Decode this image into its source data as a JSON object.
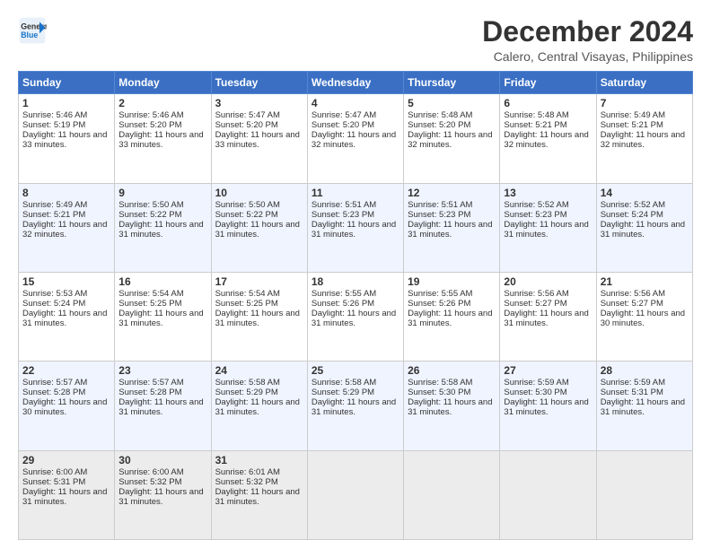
{
  "logo": {
    "line1": "General",
    "line2": "Blue"
  },
  "title": "December 2024",
  "subtitle": "Calero, Central Visayas, Philippines",
  "days": [
    "Sunday",
    "Monday",
    "Tuesday",
    "Wednesday",
    "Thursday",
    "Friday",
    "Saturday"
  ],
  "weeks": [
    [
      {
        "day": 1,
        "rise": "5:46 AM",
        "set": "5:19 PM",
        "hours": "11 hours and 33 minutes."
      },
      {
        "day": 2,
        "rise": "5:46 AM",
        "set": "5:20 PM",
        "hours": "11 hours and 33 minutes."
      },
      {
        "day": 3,
        "rise": "5:47 AM",
        "set": "5:20 PM",
        "hours": "11 hours and 33 minutes."
      },
      {
        "day": 4,
        "rise": "5:47 AM",
        "set": "5:20 PM",
        "hours": "11 hours and 32 minutes."
      },
      {
        "day": 5,
        "rise": "5:48 AM",
        "set": "5:20 PM",
        "hours": "11 hours and 32 minutes."
      },
      {
        "day": 6,
        "rise": "5:48 AM",
        "set": "5:21 PM",
        "hours": "11 hours and 32 minutes."
      },
      {
        "day": 7,
        "rise": "5:49 AM",
        "set": "5:21 PM",
        "hours": "11 hours and 32 minutes."
      }
    ],
    [
      {
        "day": 8,
        "rise": "5:49 AM",
        "set": "5:21 PM",
        "hours": "11 hours and 32 minutes."
      },
      {
        "day": 9,
        "rise": "5:50 AM",
        "set": "5:22 PM",
        "hours": "11 hours and 31 minutes."
      },
      {
        "day": 10,
        "rise": "5:50 AM",
        "set": "5:22 PM",
        "hours": "11 hours and 31 minutes."
      },
      {
        "day": 11,
        "rise": "5:51 AM",
        "set": "5:23 PM",
        "hours": "11 hours and 31 minutes."
      },
      {
        "day": 12,
        "rise": "5:51 AM",
        "set": "5:23 PM",
        "hours": "11 hours and 31 minutes."
      },
      {
        "day": 13,
        "rise": "5:52 AM",
        "set": "5:23 PM",
        "hours": "11 hours and 31 minutes."
      },
      {
        "day": 14,
        "rise": "5:52 AM",
        "set": "5:24 PM",
        "hours": "11 hours and 31 minutes."
      }
    ],
    [
      {
        "day": 15,
        "rise": "5:53 AM",
        "set": "5:24 PM",
        "hours": "11 hours and 31 minutes."
      },
      {
        "day": 16,
        "rise": "5:54 AM",
        "set": "5:25 PM",
        "hours": "11 hours and 31 minutes."
      },
      {
        "day": 17,
        "rise": "5:54 AM",
        "set": "5:25 PM",
        "hours": "11 hours and 31 minutes."
      },
      {
        "day": 18,
        "rise": "5:55 AM",
        "set": "5:26 PM",
        "hours": "11 hours and 31 minutes."
      },
      {
        "day": 19,
        "rise": "5:55 AM",
        "set": "5:26 PM",
        "hours": "11 hours and 31 minutes."
      },
      {
        "day": 20,
        "rise": "5:56 AM",
        "set": "5:27 PM",
        "hours": "11 hours and 31 minutes."
      },
      {
        "day": 21,
        "rise": "5:56 AM",
        "set": "5:27 PM",
        "hours": "11 hours and 30 minutes."
      }
    ],
    [
      {
        "day": 22,
        "rise": "5:57 AM",
        "set": "5:28 PM",
        "hours": "11 hours and 30 minutes."
      },
      {
        "day": 23,
        "rise": "5:57 AM",
        "set": "5:28 PM",
        "hours": "11 hours and 31 minutes."
      },
      {
        "day": 24,
        "rise": "5:58 AM",
        "set": "5:29 PM",
        "hours": "11 hours and 31 minutes."
      },
      {
        "day": 25,
        "rise": "5:58 AM",
        "set": "5:29 PM",
        "hours": "11 hours and 31 minutes."
      },
      {
        "day": 26,
        "rise": "5:58 AM",
        "set": "5:30 PM",
        "hours": "11 hours and 31 minutes."
      },
      {
        "day": 27,
        "rise": "5:59 AM",
        "set": "5:30 PM",
        "hours": "11 hours and 31 minutes."
      },
      {
        "day": 28,
        "rise": "5:59 AM",
        "set": "5:31 PM",
        "hours": "11 hours and 31 minutes."
      }
    ],
    [
      {
        "day": 29,
        "rise": "6:00 AM",
        "set": "5:31 PM",
        "hours": "11 hours and 31 minutes."
      },
      {
        "day": 30,
        "rise": "6:00 AM",
        "set": "5:32 PM",
        "hours": "11 hours and 31 minutes."
      },
      {
        "day": 31,
        "rise": "6:01 AM",
        "set": "5:32 PM",
        "hours": "11 hours and 31 minutes."
      },
      null,
      null,
      null,
      null
    ]
  ]
}
